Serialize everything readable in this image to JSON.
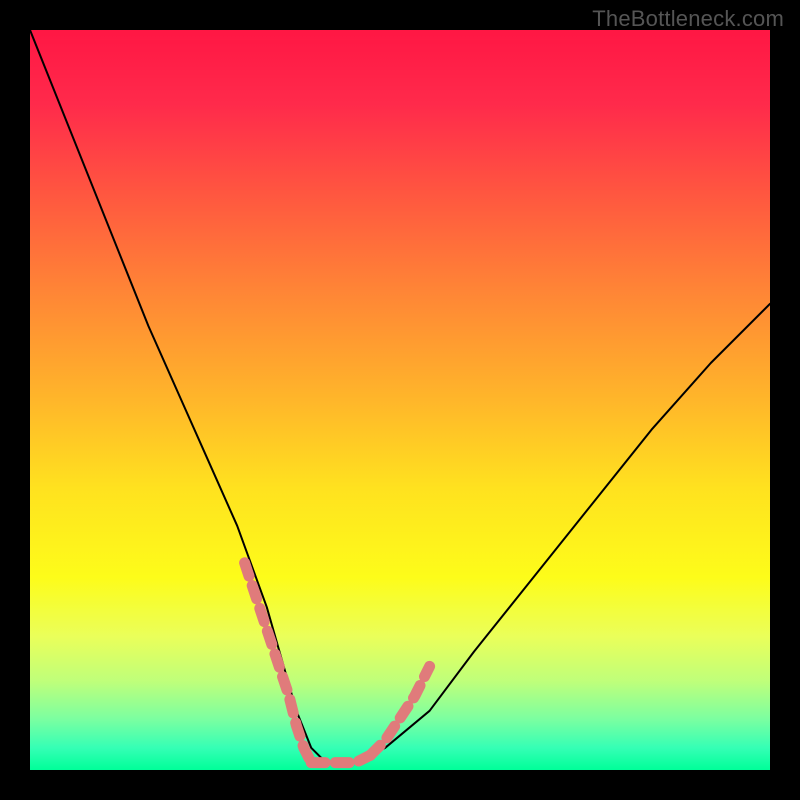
{
  "watermark": "TheBottleneck.com",
  "chart_data": {
    "type": "line",
    "title": "",
    "xlabel": "",
    "ylabel": "",
    "xlim": [
      0,
      100
    ],
    "ylim": [
      0,
      100
    ],
    "grid": false,
    "legend": false,
    "annotations": [],
    "background_gradient_stops": [
      {
        "pct": 0,
        "color": "#ff1744"
      },
      {
        "pct": 10,
        "color": "#ff2a4b"
      },
      {
        "pct": 22,
        "color": "#ff5640"
      },
      {
        "pct": 35,
        "color": "#ff8436"
      },
      {
        "pct": 50,
        "color": "#ffb62a"
      },
      {
        "pct": 62,
        "color": "#ffe21f"
      },
      {
        "pct": 74,
        "color": "#fdfc1a"
      },
      {
        "pct": 82,
        "color": "#eaff5a"
      },
      {
        "pct": 88,
        "color": "#bfff7a"
      },
      {
        "pct": 93,
        "color": "#7dffa0"
      },
      {
        "pct": 97,
        "color": "#35ffb5"
      },
      {
        "pct": 100,
        "color": "#00ff99"
      }
    ],
    "series": [
      {
        "name": "bottleneck-curve",
        "stroke": "#000000",
        "stroke_width": 2,
        "x": [
          0,
          4,
          8,
          12,
          16,
          20,
          24,
          28,
          32,
          34,
          36,
          38,
          40,
          44,
          48,
          54,
          60,
          68,
          76,
          84,
          92,
          100
        ],
        "y": [
          100,
          90,
          80,
          70,
          60,
          51,
          42,
          33,
          22,
          15,
          8,
          3,
          1,
          1,
          3,
          8,
          16,
          26,
          36,
          46,
          55,
          63
        ]
      }
    ],
    "highlight_segments": [
      {
        "name": "highlight-left",
        "stroke": "#e07b7b",
        "stroke_width": 11,
        "x": [
          29,
          31,
          33,
          35,
          36,
          37,
          38
        ],
        "y": [
          28,
          22,
          16,
          10,
          6,
          3,
          1
        ]
      },
      {
        "name": "highlight-bottom",
        "stroke": "#e07b7b",
        "stroke_width": 11,
        "x": [
          38,
          40,
          42,
          44,
          46
        ],
        "y": [
          1,
          1,
          1,
          1,
          2
        ]
      },
      {
        "name": "highlight-right",
        "stroke": "#e07b7b",
        "stroke_width": 11,
        "x": [
          46,
          48,
          50,
          52,
          54
        ],
        "y": [
          2,
          4,
          7,
          10,
          14
        ]
      }
    ]
  }
}
